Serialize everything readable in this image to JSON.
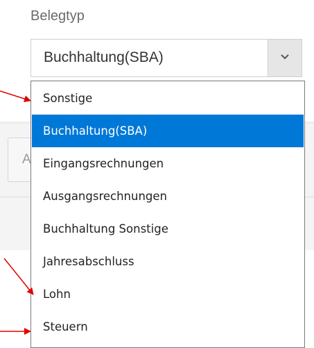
{
  "field": {
    "label": "Belegtyp",
    "selected_value": "Buchhaltung(SBA)"
  },
  "background": {
    "partial_text": "A"
  },
  "dropdown": {
    "options": [
      {
        "label": "Sonstige",
        "selected": false
      },
      {
        "label": "Buchhaltung(SBA)",
        "selected": true
      },
      {
        "label": "Eingangsrechnungen",
        "selected": false
      },
      {
        "label": "Ausgangsrechnungen",
        "selected": false
      },
      {
        "label": "Buchhaltung Sonstige",
        "selected": false
      },
      {
        "label": "Jahresabschluss",
        "selected": false
      },
      {
        "label": "Lohn",
        "selected": false
      },
      {
        "label": "Steuern",
        "selected": false
      }
    ]
  },
  "colors": {
    "selected_bg": "#0078d7",
    "annotation_arrow": "#e00000"
  },
  "icons": {
    "dropdown_toggle": "chevron-down-icon"
  }
}
